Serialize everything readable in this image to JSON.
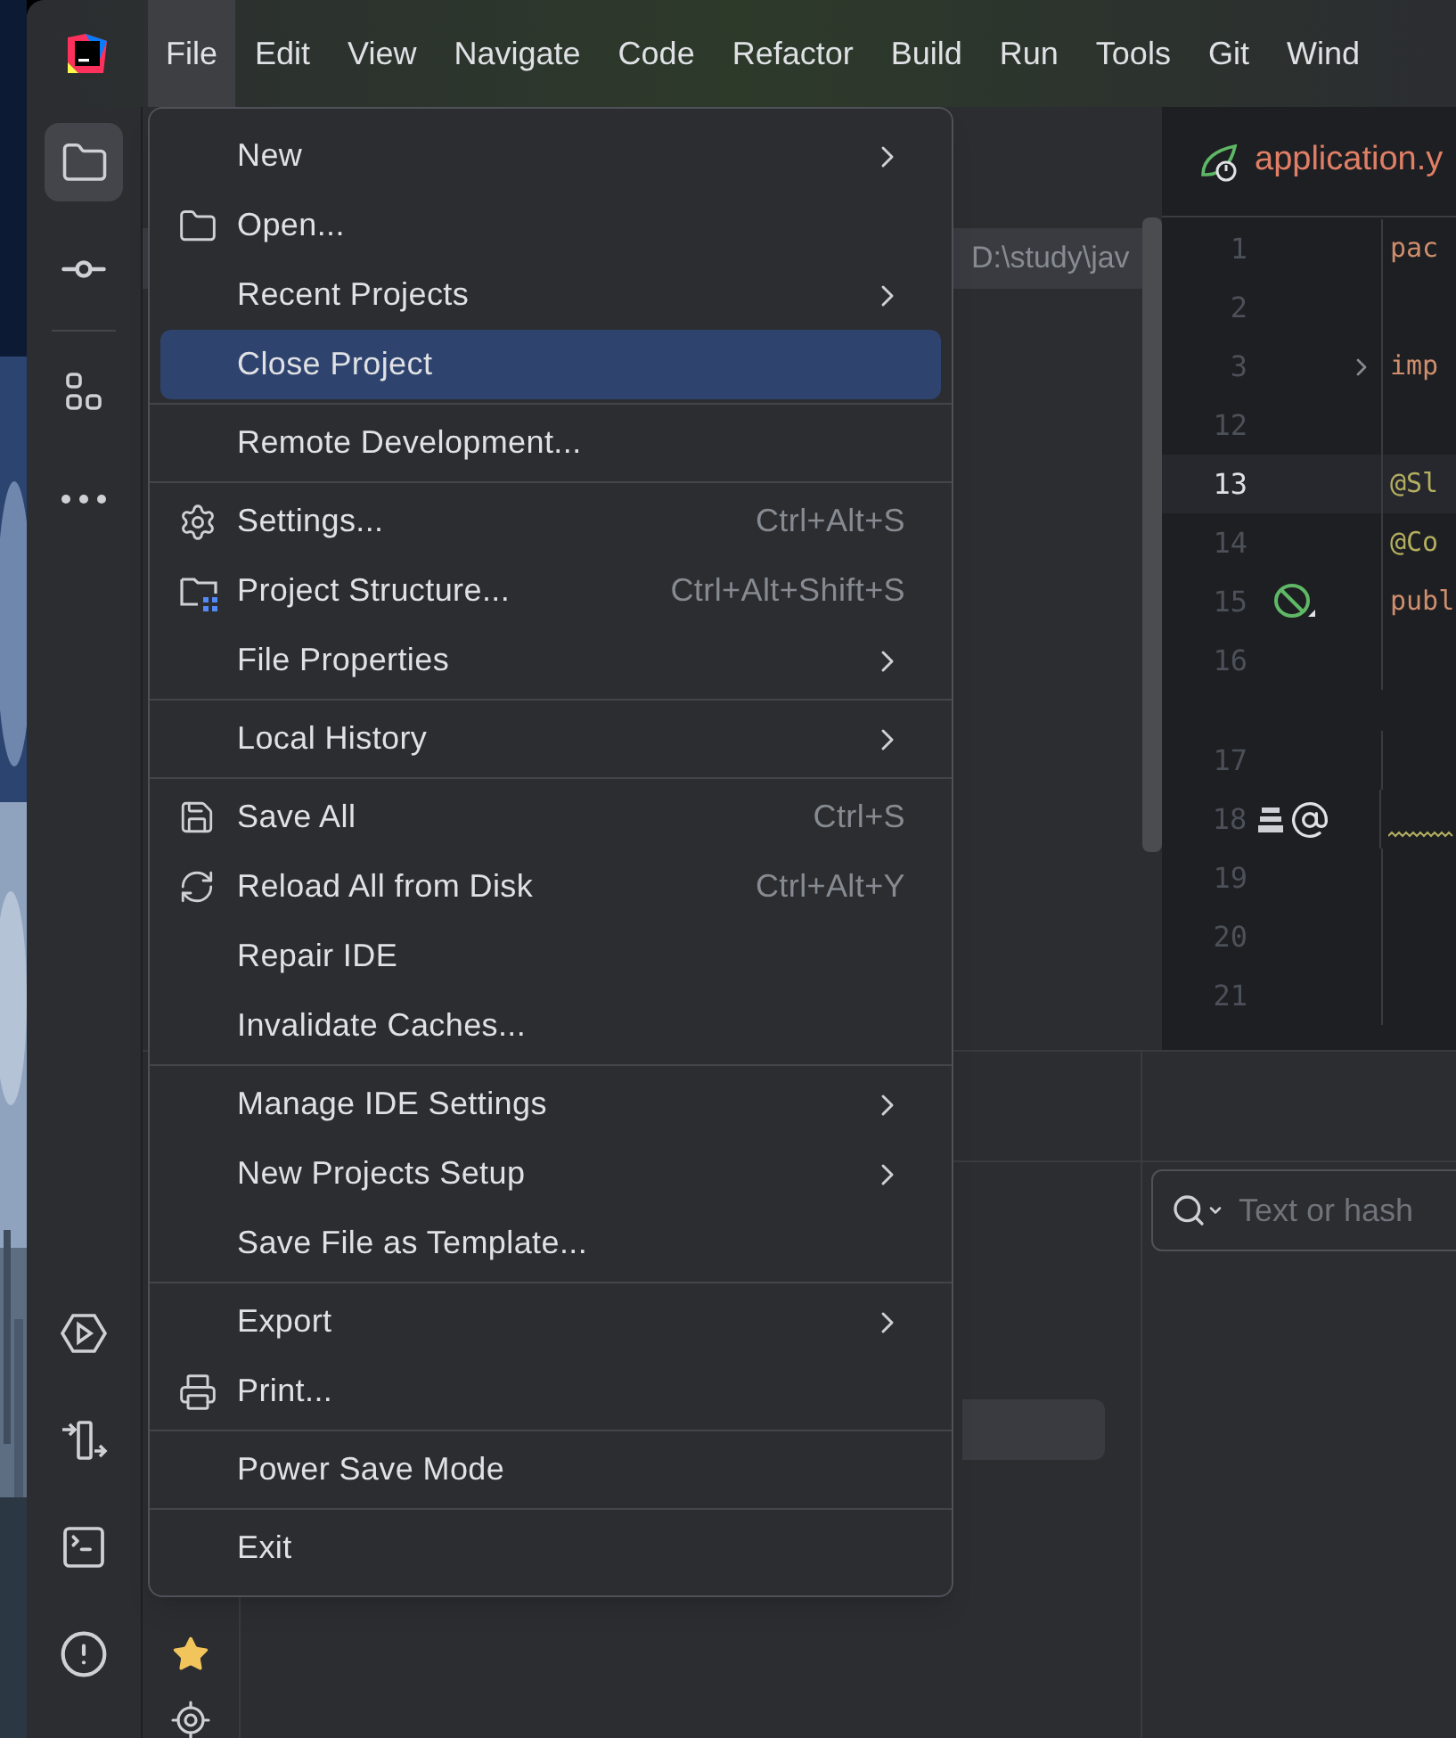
{
  "menubar": {
    "items": [
      {
        "label": "File",
        "selected": true
      },
      {
        "label": "Edit",
        "selected": false
      },
      {
        "label": "View",
        "selected": false
      },
      {
        "label": "Navigate",
        "selected": false
      },
      {
        "label": "Code",
        "selected": false
      },
      {
        "label": "Refactor",
        "selected": false
      },
      {
        "label": "Build",
        "selected": false
      },
      {
        "label": "Run",
        "selected": false
      },
      {
        "label": "Tools",
        "selected": false
      },
      {
        "label": "Git",
        "selected": false
      },
      {
        "label": "Wind",
        "selected": false
      }
    ]
  },
  "left_toolbar": {
    "top": [
      {
        "kind": "folder",
        "selected": true
      },
      {
        "kind": "commit",
        "selected": false
      },
      {
        "kind": "structure",
        "selected": false
      },
      {
        "kind": "more",
        "selected": false
      }
    ],
    "bottom": [
      {
        "kind": "run",
        "selected": false
      },
      {
        "kind": "pull",
        "selected": false
      },
      {
        "kind": "terminal",
        "selected": false
      },
      {
        "kind": "problems",
        "selected": false
      }
    ]
  },
  "side_stripe": [
    {
      "kind": "star"
    },
    {
      "kind": "crosshair"
    }
  ],
  "project_panel": {
    "path": "D:\\study\\jav"
  },
  "editor": {
    "tab": {
      "label": "application.y"
    },
    "lines": [
      {
        "number": "1",
        "code": "pac",
        "kind": "keyword",
        "current": false,
        "fold": false,
        "warning": false,
        "inlay_above": false
      },
      {
        "number": "2",
        "current": false,
        "fold": false,
        "warning": false,
        "inlay_above": false
      },
      {
        "number": "3",
        "code": "imp",
        "kind": "keyword",
        "current": false,
        "fold": true,
        "warning": false,
        "inlay_above": false
      },
      {
        "number": "12",
        "current": false,
        "fold": false,
        "warning": false,
        "inlay_above": false
      },
      {
        "number": "13",
        "code": "@Sl",
        "kind": "annotation",
        "current": true,
        "fold": false,
        "warning": false,
        "inlay_above": false
      },
      {
        "number": "14",
        "code": "@Co",
        "kind": "annotation",
        "current": false,
        "fold": false,
        "warning": false,
        "inlay_above": false
      },
      {
        "number": "15",
        "code": "publ",
        "kind": "keyword",
        "gutter": [
          {
            "kind": "bean"
          }
        ],
        "current": false,
        "fold": false,
        "warning": false,
        "inlay_above": false
      },
      {
        "number": "16",
        "current": false,
        "fold": false,
        "warning": false,
        "inlay_above": false
      },
      {
        "number": "17",
        "current": false,
        "fold": false,
        "warning": false,
        "inlay_above": true
      },
      {
        "number": "18",
        "gutter": [
          {
            "kind": "stack"
          },
          {
            "kind": "at"
          }
        ],
        "current": false,
        "fold": false,
        "warning": true,
        "inlay_above": false
      },
      {
        "number": "19",
        "current": false,
        "fold": false,
        "warning": false,
        "inlay_above": false
      },
      {
        "number": "20",
        "current": false,
        "fold": false,
        "warning": false,
        "inlay_above": false
      },
      {
        "number": "21",
        "current": false,
        "fold": false,
        "warning": false,
        "inlay_above": false
      }
    ]
  },
  "log_panel": {
    "search": {
      "placeholder": "Text or hash"
    }
  },
  "file_menu": {
    "groups": [
      [
        {
          "label": "New",
          "submenu": true,
          "selected": false
        },
        {
          "label": "Open...",
          "kind": "folder",
          "submenu": false,
          "selected": false
        },
        {
          "label": "Recent Projects",
          "submenu": true,
          "selected": false
        },
        {
          "label": "Close Project",
          "submenu": false,
          "selected": true
        }
      ],
      [
        {
          "label": "Remote Development...",
          "submenu": false,
          "selected": false
        }
      ],
      [
        {
          "label": "Settings...",
          "kind": "gear",
          "shortcut": "Ctrl+Alt+S",
          "submenu": false,
          "selected": false
        },
        {
          "label": "Project Structure...",
          "kind": "project-structure",
          "shortcut": "Ctrl+Alt+Shift+S",
          "submenu": false,
          "selected": false
        },
        {
          "label": "File Properties",
          "submenu": true,
          "selected": false
        }
      ],
      [
        {
          "label": "Local History",
          "submenu": true,
          "selected": false
        }
      ],
      [
        {
          "label": "Save All",
          "kind": "save",
          "shortcut": "Ctrl+S",
          "submenu": false,
          "selected": false
        },
        {
          "label": "Reload All from Disk",
          "kind": "reload",
          "shortcut": "Ctrl+Alt+Y",
          "submenu": false,
          "selected": false
        },
        {
          "label": "Repair IDE",
          "submenu": false,
          "selected": false
        },
        {
          "label": "Invalidate Caches...",
          "submenu": false,
          "selected": false
        }
      ],
      [
        {
          "label": "Manage IDE Settings",
          "submenu": true,
          "selected": false
        },
        {
          "label": "New Projects Setup",
          "submenu": true,
          "selected": false
        },
        {
          "label": "Save File as Template...",
          "submenu": false,
          "selected": false
        }
      ],
      [
        {
          "label": "Export",
          "submenu": true,
          "selected": false
        },
        {
          "label": "Print...",
          "kind": "printer",
          "submenu": false,
          "selected": false
        }
      ],
      [
        {
          "label": "Power Save Mode",
          "submenu": false,
          "selected": false
        }
      ],
      [
        {
          "label": "Exit",
          "submenu": false,
          "selected": false
        }
      ]
    ]
  }
}
